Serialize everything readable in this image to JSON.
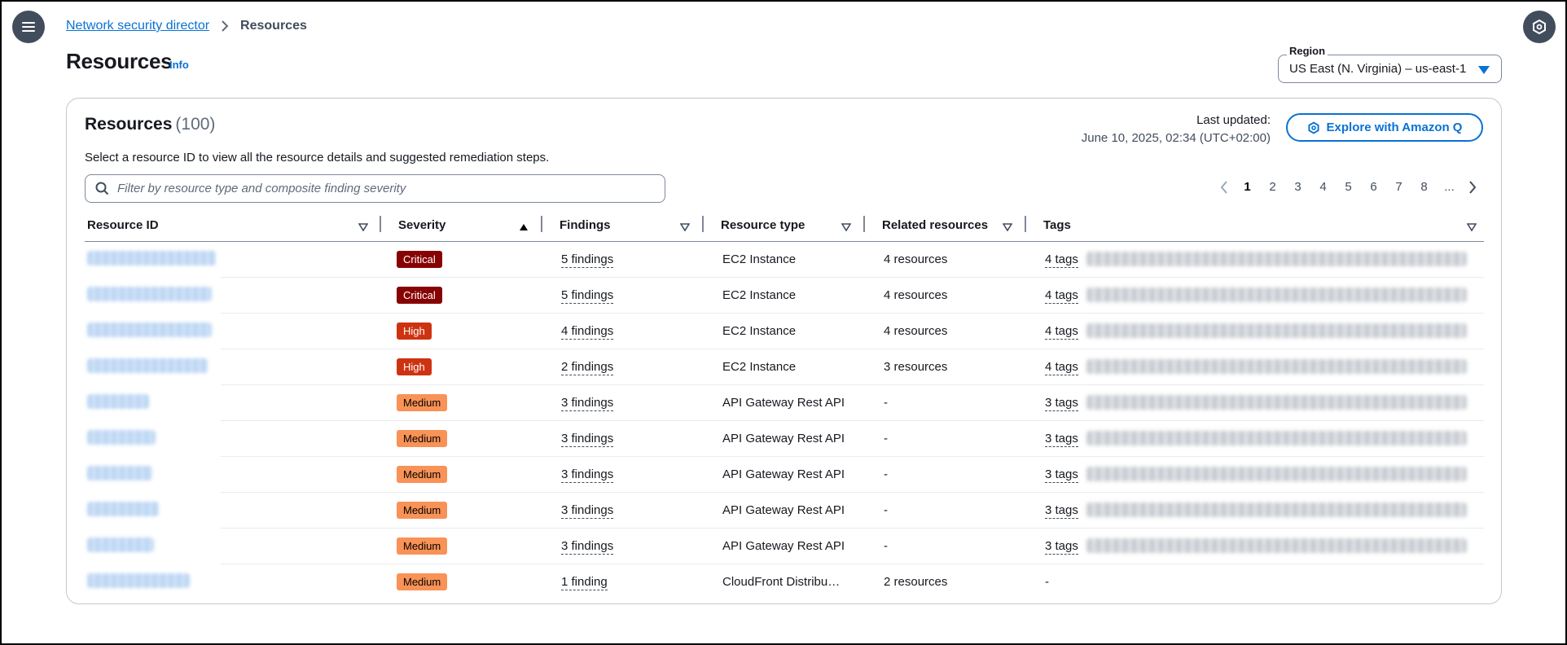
{
  "nav": {
    "menu_icon": "hamburger-icon",
    "help_icon": "amazon-q-icon"
  },
  "breadcrumb": {
    "parent": "Network security director",
    "current": "Resources"
  },
  "page": {
    "title": "Resources",
    "info": "Info"
  },
  "region": {
    "label": "Region",
    "value": "US East (N. Virginia) – us-east-1"
  },
  "table_header": {
    "title": "Resources",
    "count": "(100)",
    "description": "Select a resource ID to view all the resource details and suggested remediation steps.",
    "last_updated_label": "Last updated:",
    "last_updated_value": "June 10, 2025, 02:34 (UTC+02:00)",
    "amazon_q_button": "Explore with Amazon Q"
  },
  "search": {
    "placeholder": "Filter by resource type and composite finding severity"
  },
  "pagination": {
    "pages": [
      "1",
      "2",
      "3",
      "4",
      "5",
      "6",
      "7",
      "8",
      "..."
    ],
    "current": "1"
  },
  "columns": [
    "Resource ID",
    "Severity",
    "Findings",
    "Resource type",
    "Related resources",
    "Tags"
  ],
  "severity_colors": {
    "Critical": "#870303",
    "High": "#ce3311",
    "Medium": "#f89256"
  },
  "rows": [
    {
      "severity": "Critical",
      "findings": "5 findings",
      "resource_type": "EC2 Instance",
      "related": "4 resources",
      "tags": "4 tags"
    },
    {
      "severity": "Critical",
      "findings": "5 findings",
      "resource_type": "EC2 Instance",
      "related": "4 resources",
      "tags": "4 tags"
    },
    {
      "severity": "High",
      "findings": "4 findings",
      "resource_type": "EC2 Instance",
      "related": "4 resources",
      "tags": "4 tags"
    },
    {
      "severity": "High",
      "findings": "2 findings",
      "resource_type": "EC2 Instance",
      "related": "3 resources",
      "tags": "4 tags"
    },
    {
      "severity": "Medium",
      "findings": "3 findings",
      "resource_type": "API Gateway Rest API",
      "related": "-",
      "tags": "3 tags"
    },
    {
      "severity": "Medium",
      "findings": "3 findings",
      "resource_type": "API Gateway Rest API",
      "related": "-",
      "tags": "3 tags"
    },
    {
      "severity": "Medium",
      "findings": "3 findings",
      "resource_type": "API Gateway Rest API",
      "related": "-",
      "tags": "3 tags"
    },
    {
      "severity": "Medium",
      "findings": "3 findings",
      "resource_type": "API Gateway Rest API",
      "related": "-",
      "tags": "3 tags"
    },
    {
      "severity": "Medium",
      "findings": "3 findings",
      "resource_type": "API Gateway Rest API",
      "related": "-",
      "tags": "3 tags"
    },
    {
      "severity": "Medium",
      "findings": "1 finding",
      "resource_type": "CloudFront Distribu…",
      "related": "2 resources",
      "tags": "-"
    }
  ]
}
